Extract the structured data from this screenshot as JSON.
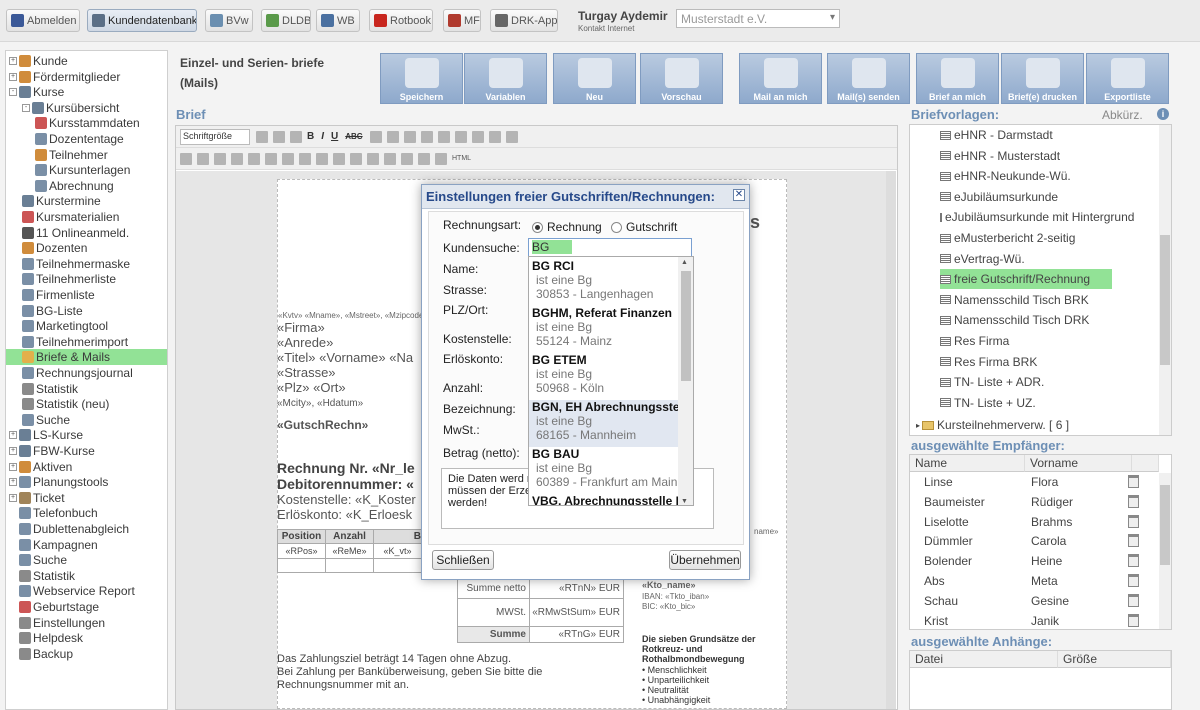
{
  "topbar": {
    "buttons": [
      {
        "label": "Abmelden",
        "icon": "logout-icon",
        "color": "#3b5998"
      },
      {
        "label": "Kundendatenbank",
        "icon": "database-icon",
        "color": "#5b6f86"
      },
      {
        "label": "BVw",
        "icon": "bvw-icon",
        "color": "#6b8fb0"
      },
      {
        "label": "DLDB",
        "icon": "dldb-icon",
        "color": "#5a9a4a"
      },
      {
        "label": "WB",
        "icon": "wb-icon",
        "color": "#4a70a0"
      },
      {
        "label": "Rotbook",
        "icon": "rotbook-icon",
        "color": "#c8261e"
      },
      {
        "label": "MF",
        "icon": "mf-icon",
        "color": "#b03a2e"
      },
      {
        "label": "DRK-App",
        "icon": "phone-icon",
        "color": "#666666"
      }
    ],
    "user_name": "Turgay Aydemir",
    "user_sub": "Kontakt Internet",
    "org_select": "Musterstadt e.V."
  },
  "nav": [
    {
      "label": "Kunde",
      "pm": "+",
      "indent": 0,
      "icon": "person-icon",
      "color": "#d08c3c"
    },
    {
      "label": "Fördermitglieder",
      "pm": "+",
      "indent": 0,
      "icon": "person-icon",
      "color": "#d08c3c"
    },
    {
      "label": "Kurse",
      "pm": "-",
      "indent": 0,
      "icon": "course-icon",
      "color": "#6a7f95"
    },
    {
      "label": "Kursübersicht",
      "pm": "-",
      "indent": 1,
      "icon": "course-icon",
      "color": "#6a7f95"
    },
    {
      "label": "Kursstammdaten",
      "pm": "",
      "indent": 2,
      "icon": "table-icon",
      "color": "#c55"
    },
    {
      "label": "Dozententage",
      "pm": "",
      "indent": 2,
      "icon": "calendar-icon",
      "color": "#7a8fa6"
    },
    {
      "label": "Teilnehmer",
      "pm": "",
      "indent": 2,
      "icon": "person-icon",
      "color": "#d08c3c"
    },
    {
      "label": "Kursunterlagen",
      "pm": "",
      "indent": 2,
      "icon": "document-icon",
      "color": "#7a8fa6"
    },
    {
      "label": "Abrechnung",
      "pm": "",
      "indent": 2,
      "icon": "invoice-icon",
      "color": "#7a8fa6"
    },
    {
      "label": "Kurstermine",
      "pm": "",
      "indent": 1,
      "icon": "course-icon",
      "color": "#6a7f95"
    },
    {
      "label": "Kursmaterialien",
      "pm": "",
      "indent": 1,
      "icon": "table-icon",
      "color": "#c55"
    },
    {
      "label": "11 Onlineanmeld.",
      "pm": "",
      "indent": 1,
      "icon": "eye-icon",
      "color": "#555"
    },
    {
      "label": "Dozenten",
      "pm": "",
      "indent": 1,
      "icon": "person-icon",
      "color": "#d08c3c"
    },
    {
      "label": "Teilnehmermaske",
      "pm": "",
      "indent": 1,
      "icon": "form-icon",
      "color": "#7a8fa6"
    },
    {
      "label": "Teilnehmerliste",
      "pm": "",
      "indent": 1,
      "icon": "list-icon",
      "color": "#7a8fa6"
    },
    {
      "label": "Firmenliste",
      "pm": "",
      "indent": 1,
      "icon": "list-icon",
      "color": "#7a8fa6"
    },
    {
      "label": "BG-Liste",
      "pm": "",
      "indent": 1,
      "icon": "list-icon",
      "color": "#7a8fa6"
    },
    {
      "label": "Marketingtool",
      "pm": "",
      "indent": 1,
      "icon": "marketing-icon",
      "color": "#7a8fa6"
    },
    {
      "label": "Teilnehmerimport",
      "pm": "",
      "indent": 1,
      "icon": "import-icon",
      "color": "#7a8fa6"
    },
    {
      "label": "Briefe & Mails",
      "pm": "",
      "indent": 1,
      "icon": "letter-icon",
      "color": "#e3b04b",
      "selected": true
    },
    {
      "label": "Rechnungsjournal",
      "pm": "",
      "indent": 1,
      "icon": "journal-icon",
      "color": "#7a8fa6"
    },
    {
      "label": "Statistik",
      "pm": "",
      "indent": 1,
      "icon": "chart-icon",
      "color": "#8a8a8a"
    },
    {
      "label": "Statistik (neu)",
      "pm": "",
      "indent": 1,
      "icon": "chart-icon",
      "color": "#8a8a8a"
    },
    {
      "label": "Suche",
      "pm": "",
      "indent": 1,
      "icon": "search-icon",
      "color": "#7a8fa6"
    },
    {
      "label": "LS-Kurse",
      "pm": "+",
      "indent": 0,
      "icon": "course-icon",
      "color": "#6a7f95"
    },
    {
      "label": "FBW-Kurse",
      "pm": "+",
      "indent": 0,
      "icon": "course-icon",
      "color": "#6a7f95"
    },
    {
      "label": "Aktiven",
      "pm": "+",
      "indent": 0,
      "icon": "person-icon",
      "color": "#d08c3c"
    },
    {
      "label": "Planungstools",
      "pm": "+",
      "indent": 0,
      "icon": "tools-icon",
      "color": "#7a8fa6"
    },
    {
      "label": "Ticket",
      "pm": "+",
      "indent": 0,
      "icon": "ticket-icon",
      "color": "#a0845a"
    },
    {
      "label": "Telefonbuch",
      "pm": "",
      "indent": 0,
      "icon": "phone-icon",
      "color": "#7a8fa6"
    },
    {
      "label": "Dublettenabgleich",
      "pm": "",
      "indent": 0,
      "icon": "duplicate-icon",
      "color": "#7a8fa6"
    },
    {
      "label": "Kampagnen",
      "pm": "",
      "indent": 0,
      "icon": "campaign-icon",
      "color": "#7a8fa6"
    },
    {
      "label": "Suche",
      "pm": "",
      "indent": 0,
      "icon": "search-icon",
      "color": "#7a8fa6"
    },
    {
      "label": "Statistik",
      "pm": "",
      "indent": 0,
      "icon": "chart-icon",
      "color": "#8a8a8a"
    },
    {
      "label": "Webservice Report",
      "pm": "",
      "indent": 0,
      "icon": "report-icon",
      "color": "#7a8fa6"
    },
    {
      "label": "Geburtstage",
      "pm": "",
      "indent": 0,
      "icon": "birthday-icon",
      "color": "#c55"
    },
    {
      "label": "Einstellungen",
      "pm": "",
      "indent": 0,
      "icon": "gear-icon",
      "color": "#8a8a8a"
    },
    {
      "label": "Helpdesk",
      "pm": "",
      "indent": 0,
      "icon": "help-icon",
      "color": "#8a8a8a"
    },
    {
      "label": "Backup",
      "pm": "",
      "indent": 0,
      "icon": "backup-icon",
      "color": "#8a8a8a"
    }
  ],
  "main": {
    "title_line1": "Einzel- und Serien- briefe",
    "title_line2": "(Mails)",
    "section_label": "Brief",
    "ribbon": [
      {
        "label": "Speichern",
        "icon": "save-icon"
      },
      {
        "label": "Variablen",
        "icon": "variables-icon"
      },
      {
        "label": "Neu",
        "icon": "new-icon"
      },
      {
        "label": "Vorschau",
        "icon": "preview-icon"
      },
      {
        "label": "Mail an mich",
        "icon": "mail-icon"
      },
      {
        "label": "Mail(s) senden",
        "icon": "mails-icon"
      },
      {
        "label": "Brief an mich",
        "icon": "letter-icon"
      },
      {
        "label": "Brief(e) drucken",
        "icon": "print-icon"
      },
      {
        "label": "Exportliste",
        "icon": "export-icon"
      }
    ],
    "editor": {
      "font_size_select": "Schriftgröße",
      "format_buttons": [
        "B",
        "I",
        "U",
        "ABC"
      ],
      "html_button": "HTML"
    }
  },
  "letter": {
    "variables_header": "«Kvtv» «Mname», «Mstreet», «Mzipcode»",
    "address_lines": [
      "«Firma»",
      "«Anrede»",
      "«Titel» «Vorname» «Na",
      "«Strasse»",
      "«Plz» «Ort»"
    ],
    "date_line": "«Mcity», «Hdatum»",
    "heading_var": "«GutschRechn»",
    "invoice_title": "Rechnung Nr. «Nr_le",
    "debtor_line": "Debitorennummer: «",
    "cost_center_line": "Kostenstelle: «K_Koster",
    "revenue_line": "Erlöskonto: «K_Erloesk",
    "table_headers": [
      "Position",
      "Anzahl",
      "B"
    ],
    "table_row": [
      "«RPos»",
      "«ReMe»",
      "«K_vt»"
    ],
    "sum_rows": [
      {
        "label": "Summe netto",
        "value": "«RTnN» EUR"
      },
      {
        "label": "MWSt.",
        "value": "«RMwStSum» EUR"
      },
      {
        "label": "Summe",
        "value": "«RTnG» EUR"
      }
    ],
    "bank": {
      "name": "«Kto_name»",
      "iban": "IBAN: «Tkto_iban»",
      "bic": "BIC: «Kto_bic»",
      "partial": "name»"
    },
    "payment_text": [
      "Das Zahlungsziel beträgt 14 Tagen ohne Abzug.",
      "Bei Zahlung per Banküberweisung, geben Sie bitte die",
      "Rechnungsnummer mit an."
    ],
    "principles_title": "Die sieben Grundsätze der Rotkreuz- und Rothalbmondbewegung",
    "principles": [
      "• Menschlichkeit",
      "• Unparteilichkeit",
      "• Neutralität",
      "• Unabhängigkeit"
    ],
    "partial_s": "s"
  },
  "dialog": {
    "title": "Einstellungen freier Gutschriften/Rechnungen:",
    "close": "✕",
    "labels": {
      "rechnungsart": "Rechnungsart:",
      "kundensuche": "Kundensuche:",
      "name": "Name:",
      "strasse": "Strasse:",
      "plz": "PLZ/Ort:",
      "kostenstelle": "Kostenstelle:",
      "erloeskonto": "Erlöskonto:",
      "anzahl": "Anzahl:",
      "bezeichnung": "Bezeichnung:",
      "mwst": "MwSt.:",
      "betrag": "Betrag (netto):"
    },
    "radio_rechnung": "Rechnung",
    "radio_gutschrift": "Gutschrift",
    "search_value": "BG",
    "results": [
      {
        "name": "BG RCI",
        "type": "ist eine Bg",
        "place": "30853 - Langenhagen"
      },
      {
        "name": "BGHM, Referat Finanzen",
        "type": "ist eine Bg",
        "place": "55124 - Mainz"
      },
      {
        "name": "BG ETEM",
        "type": "ist eine Bg",
        "place": "50968 - Köln"
      },
      {
        "name": "BGN, EH Abrechnungsste",
        "type": "ist eine Bg",
        "place": "68165 - Mannheim",
        "highlight": true
      },
      {
        "name": "BG BAU",
        "type": "ist eine Bg",
        "place": "60389 - Frankfurt am Main"
      },
      {
        "name": "VBG, Abrechnungsstelle I",
        "type": "",
        "place": ""
      }
    ],
    "info_text": "Die Daten werd                                    nd können nicht ge                                   en Angaben müssen der Erzeugung vom erbr erneut bestätigt werden!",
    "btn_close": "Schließen",
    "btn_apply": "Übernehmen"
  },
  "right": {
    "templates_label": "Briefvorlagen:",
    "abbr_label": "Abkürz.",
    "templates": [
      "eHNR - Darmstadt",
      "eHNR - Musterstadt",
      "eHNR-Neukunde-Wü.",
      "eJubiläumsurkunde",
      "eJubiläumsurkunde mit Hintergrund",
      "eMusterbericht 2-seitig",
      "eVertrag-Wü.",
      "freie Gutschrift/Rechnung",
      "Namensschild Tisch BRK",
      "Namensschild Tisch DRK",
      "Res Firma",
      "Res Firma BRK",
      "TN- Liste + ADR.",
      "TN- Liste + UZ."
    ],
    "selected_template": 7,
    "folder_label": "Kursteilnehmerverw. [ 6 ]",
    "recipients_label": "ausgewählte Empfänger:",
    "recipients_cols": [
      "Name",
      "Vorname"
    ],
    "recipients": [
      [
        "Linse",
        "Flora"
      ],
      [
        "Baumeister",
        "Rüdiger"
      ],
      [
        "Liselotte",
        "Brahms"
      ],
      [
        "Dümmler",
        "Carola"
      ],
      [
        "Bolender",
        "Heine"
      ],
      [
        "Abs",
        "Meta"
      ],
      [
        "Schau",
        "Gesine"
      ],
      [
        "Krist",
        "Janik"
      ]
    ],
    "attachments_label": "ausgewählte Anhänge:",
    "attachments_cols": [
      "Datei",
      "Größe"
    ]
  },
  "colors": {
    "accent_blue": "#6d8fb5",
    "selected_green": "#92e296",
    "dialog_title": "#26498a"
  }
}
